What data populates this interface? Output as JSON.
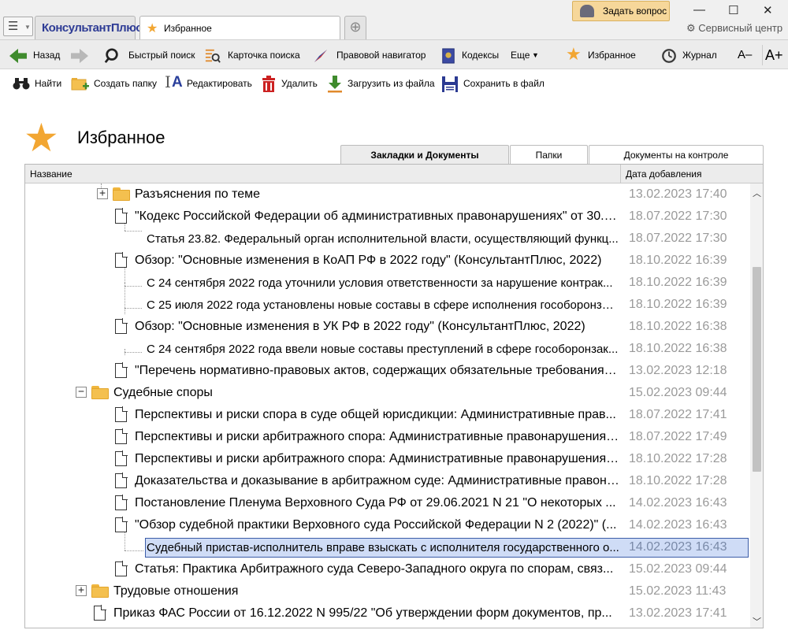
{
  "titlebar": {
    "brand": "КонсультантПлюс",
    "active_tab": "Избранное",
    "ask_button": "Задать вопрос",
    "service_center": "Сервисный центр"
  },
  "toolbar": {
    "back": "Назад",
    "quick_search": "Быстрый поиск",
    "search_card": "Карточка поиска",
    "legal_navigator": "Правовой навигатор",
    "codes": "Кодексы",
    "more": "Еще",
    "favorites": "Избранное",
    "journal": "Журнал",
    "font_decrease": "A–",
    "font_increase": "A+"
  },
  "actions": {
    "find": "Найти",
    "create_folder": "Создать папку",
    "edit": "Редактировать",
    "delete": "Удалить",
    "load_from_file": "Загрузить из файла",
    "save_to_file": "Сохранить в файл"
  },
  "page": {
    "title": "Избранное",
    "tabs": [
      "Закладки и Документы",
      "Папки",
      "Документы на контроле"
    ]
  },
  "table": {
    "col_name": "Название",
    "col_date": "Дата добавления",
    "rows": [
      {
        "label": "Разъяснения по теме",
        "date": "13.02.2023 17:40"
      },
      {
        "label": "\"Кодекс Российской Федерации об административных правонарушениях\" от 30.1...",
        "date": "18.07.2022 17:30"
      },
      {
        "label": "Статья 23.82. Федеральный орган исполнительной власти, осуществляющий функц...",
        "date": "18.07.2022 17:30"
      },
      {
        "label": "Обзор: \"Основные изменения в КоАП РФ в 2022 году\" (КонсультантПлюс, 2022)",
        "date": "18.10.2022 16:39"
      },
      {
        "label": "С 24 сентября 2022 года уточнили условия ответственности за нарушение контрак...",
        "date": "18.10.2022 16:39"
      },
      {
        "label": "С 25 июля 2022 года установлены новые составы в сфере исполнения гособоронзак...",
        "date": "18.10.2022 16:39"
      },
      {
        "label": "Обзор: \"Основные изменения в УК РФ в 2022 году\" (КонсультантПлюс, 2022)",
        "date": "18.10.2022 16:38"
      },
      {
        "label": "С 24 сентября 2022 года ввели новые составы преступлений в сфере гособоронзак...",
        "date": "18.10.2022 16:38"
      },
      {
        "label": "\"Перечень нормативно-правовых актов, содержащих обязательные требования, ...",
        "date": "13.02.2023 12:18"
      },
      {
        "label": "Судебные споры",
        "date": "15.02.2023 09:44"
      },
      {
        "label": "Перспективы и риски спора в суде общей юрисдикции: Административные прав...",
        "date": "18.07.2022 17:41"
      },
      {
        "label": "Перспективы и риски арбитражного спора: Административные правонарушения ...",
        "date": "18.07.2022 17:49"
      },
      {
        "label": "Перспективы и риски арбитражного спора: Административные правонарушения ...",
        "date": "18.10.2022 17:28"
      },
      {
        "label": "Доказательства и доказывание в арбитражном суде: Административные правона...",
        "date": "18.10.2022 17:28"
      },
      {
        "label": "Постановление Пленума Верховного Суда РФ от 29.06.2021 N 21 \"О некоторых ...",
        "date": "14.02.2023 16:43"
      },
      {
        "label": "\"Обзор судебной практики Верховного суда Российской Федерации N 2 (2022)\" (...",
        "date": "14.02.2023 16:43"
      },
      {
        "label": "Судебный пристав-исполнитель вправе взыскать с исполнителя государственного о...",
        "date": "14.02.2023 16:43"
      },
      {
        "label": "Статья: Практика Арбитражного суда Северо-Западного округа по спорам, связ...",
        "date": "15.02.2023 09:44"
      },
      {
        "label": "Трудовые отношения",
        "date": "15.02.2023 11:43"
      },
      {
        "label": "Приказ ФАС России от 16.12.2022 N 995/22 \"Об утверждении форм документов, пр...",
        "date": "13.02.2023 17:41"
      }
    ]
  },
  "colors": {
    "accent_star": "#f2a632",
    "selection_bg": "#cfdcf6",
    "selection_border": "#3c5da8",
    "date_text": "#9a9a9a"
  }
}
